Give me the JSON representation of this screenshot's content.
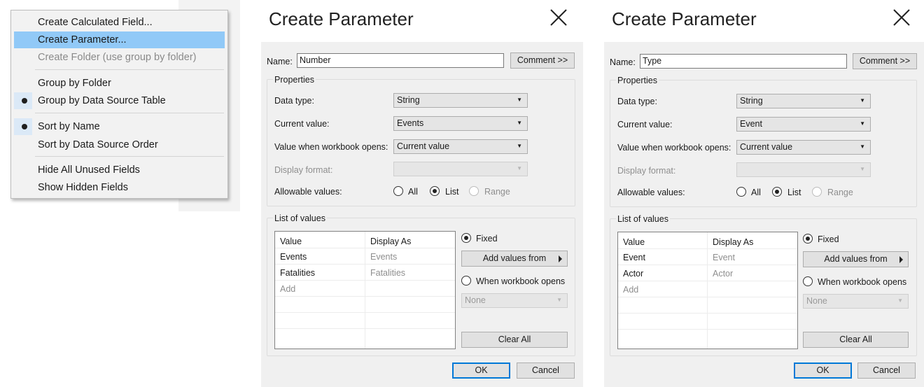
{
  "menu": {
    "items": [
      {
        "label": "Create Calculated Field..."
      },
      {
        "label": "Create Parameter..."
      },
      {
        "label": "Create Folder (use group by folder)"
      },
      {
        "label": "Group by Folder"
      },
      {
        "label": "Group by Data Source Table"
      },
      {
        "label": "Sort by Name"
      },
      {
        "label": "Sort by Data Source Order"
      },
      {
        "label": "Hide All Unused Fields"
      },
      {
        "label": "Show Hidden Fields"
      }
    ]
  },
  "dialogs": [
    {
      "title": "Create Parameter",
      "name_label": "Name:",
      "name_value": "Number",
      "comment_button": "Comment >>",
      "properties_title": "Properties",
      "data_type_label": "Data type:",
      "data_type_value": "String",
      "current_value_label": "Current value:",
      "current_value": "Events",
      "when_opens_label": "Value when workbook opens:",
      "when_opens_value": "Current value",
      "display_format_label": "Display format:",
      "allowable_label": "Allowable values:",
      "opt_all": "All",
      "opt_list": "List",
      "opt_range": "Range",
      "list_title": "List of values",
      "col_value": "Value",
      "col_display": "Display As",
      "rows": [
        {
          "value": "Events",
          "display": "Events"
        },
        {
          "value": "Fatalities",
          "display": "Fatalities"
        }
      ],
      "add_placeholder": "Add",
      "fixed_label": "Fixed",
      "add_values_button": "Add values from",
      "when_workbook_opens_label": "When workbook opens",
      "none_value": "None",
      "clear_all_button": "Clear All",
      "ok_button": "OK",
      "cancel_button": "Cancel"
    },
    {
      "title": "Create Parameter",
      "name_label": "Name:",
      "name_value": "Type",
      "comment_button": "Comment >>",
      "properties_title": "Properties",
      "data_type_label": "Data type:",
      "data_type_value": "String",
      "current_value_label": "Current value:",
      "current_value": "Event",
      "when_opens_label": "Value when workbook opens:",
      "when_opens_value": "Current value",
      "display_format_label": "Display format:",
      "allowable_label": "Allowable values:",
      "opt_all": "All",
      "opt_list": "List",
      "opt_range": "Range",
      "list_title": "List of values",
      "col_value": "Value",
      "col_display": "Display As",
      "rows": [
        {
          "value": "Event",
          "display": "Event"
        },
        {
          "value": "Actor",
          "display": "Actor"
        }
      ],
      "add_placeholder": "Add",
      "fixed_label": "Fixed",
      "add_values_button": "Add values from",
      "when_workbook_opens_label": "When workbook opens",
      "none_value": "None",
      "clear_all_button": "Clear All",
      "ok_button": "OK",
      "cancel_button": "Cancel"
    }
  ]
}
